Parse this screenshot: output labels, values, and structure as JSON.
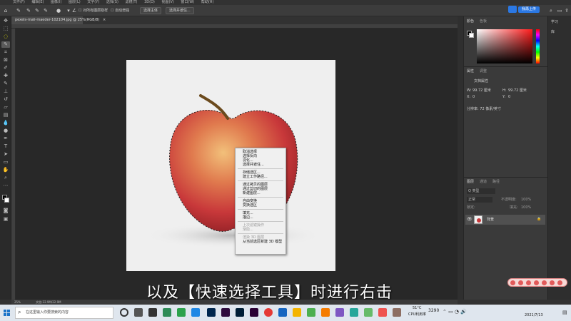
{
  "menubar": {
    "items": [
      "文件(F)",
      "编辑(E)",
      "图像(I)",
      "图层(L)",
      "文字(Y)",
      "选择(S)",
      "滤镜(T)",
      "3D(D)",
      "视图(V)",
      "窗口(W)",
      "帮助(H)"
    ]
  },
  "options": {
    "sample_all_layers": "对所有图层取样",
    "auto_enhance": "自动增强",
    "select_subject": "选择主体",
    "select_and_mask": "选择并遮住..."
  },
  "document": {
    "tab_title": "pexels-mali-maeder-102104.jpg @ 25%(RGB/8)",
    "close_symbol": "×"
  },
  "context_menu": {
    "groups": [
      [
        "取消选择",
        "选择反向",
        "羽化...",
        "选择并遮住..."
      ],
      [
        "存储选区...",
        "建立工作路径..."
      ],
      [
        "通过拷贝的图层",
        "通过剪切的图层",
        "新建图层..."
      ],
      [
        "自由变换",
        "变换选区"
      ],
      [
        "填充...",
        "描边..."
      ]
    ],
    "disabled_group": [
      "上次滤镜操作",
      "渐隐..."
    ],
    "render_3d": "渲染 3D 图层",
    "new_3d_from_selection": "从当前选区新建 3D 模型"
  },
  "subtitle": "以及【快速选择工具】时进行右击",
  "statusbar": {
    "zoom": "25%",
    "doc_info": "文档:22.9M/22.9M"
  },
  "panels": {
    "color_tab": "颜色",
    "swatches_tab": "色板",
    "properties_tab": "属性",
    "adjustments_tab": "调整",
    "doc_properties": "文档属性",
    "w_label": "W:",
    "w_value": "99.72 厘米",
    "h_label": "H:",
    "h_value": "99.72 厘米",
    "x_label": "X:",
    "x_value": "0",
    "y_label": "Y:",
    "y_value": "0",
    "resolution": "分辨率: 72 像素/英寸",
    "layers_tab": "图层",
    "channels_tab": "通道",
    "paths_tab": "路径",
    "kind_label": "Q 类型",
    "blend_mode": "正常",
    "opacity_label": "不透明度:",
    "opacity_value": "100%",
    "lock_label": "锁定:",
    "fill_label": "填充:",
    "fill_value": "100%",
    "layer_name": "背景"
  },
  "learn": {
    "learn_label": "学习",
    "library_label": "库"
  },
  "top_right": {
    "cloud_label": "我再上传"
  },
  "taskbar": {
    "search_placeholder": "在这里输入你要搜索的内容",
    "weather": "51°C",
    "cpu": "CPU利用率",
    "time": "3290",
    "date": "2021/7/13"
  },
  "colors": {
    "accent_blue": "#2b78e4",
    "taskbar_bg": "#dfe6ee",
    "panel_bg": "#3a3a3a"
  }
}
